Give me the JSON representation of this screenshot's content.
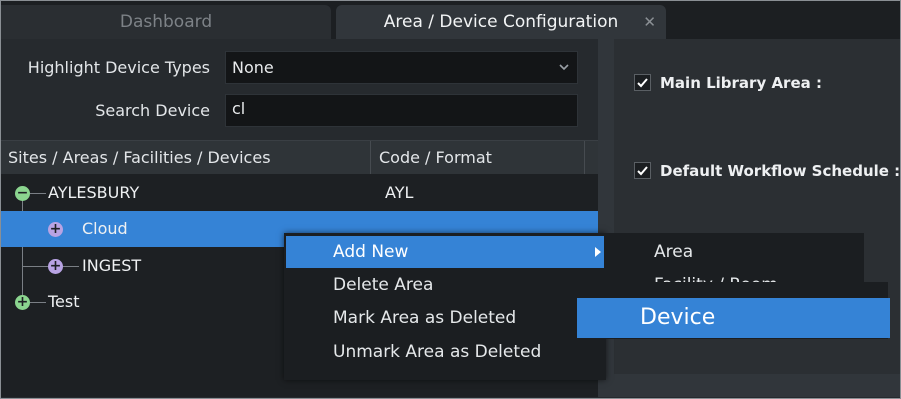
{
  "tabs": [
    {
      "label": "Dashboard",
      "active": false
    },
    {
      "label": "Area / Device Configuration",
      "active": true,
      "close_icon": "close-icon"
    }
  ],
  "filters": {
    "highlight_label": "Highlight Device Types",
    "highlight_value": "None",
    "search_label": "Search Device",
    "search_value": "cl"
  },
  "tree": {
    "columns": [
      "Sites / Areas / Facilities / Devices",
      "Code / Format"
    ],
    "rows": [
      {
        "label": "AYLESBURY",
        "code": "AYL",
        "icon": "collapse-icon",
        "selected": false
      },
      {
        "label": "Cloud",
        "code": "",
        "icon": "expand-icon",
        "selected": true
      },
      {
        "label": "INGEST",
        "code": "",
        "icon": "expand-icon",
        "selected": false
      },
      {
        "label": "Test",
        "code": "",
        "icon": "expand-icon",
        "selected": false
      }
    ]
  },
  "right_panel": {
    "checks": [
      {
        "label": "Main Library Area :",
        "checked": true
      },
      {
        "label": "Default Workflow Schedule :",
        "checked": true
      }
    ]
  },
  "context_menu": {
    "items": [
      "Add New",
      "Delete Area",
      "Mark Area as Deleted",
      "Unmark Area as Deleted"
    ],
    "active": "Add New",
    "submenu": [
      "Area",
      "Facility / Room",
      "Device"
    ],
    "submenu_active": "Device"
  },
  "colors": {
    "accent": "#3583d6",
    "background": "#262a2e",
    "node_green": "#8bd58f",
    "node_purple": "#b8a3e3"
  }
}
